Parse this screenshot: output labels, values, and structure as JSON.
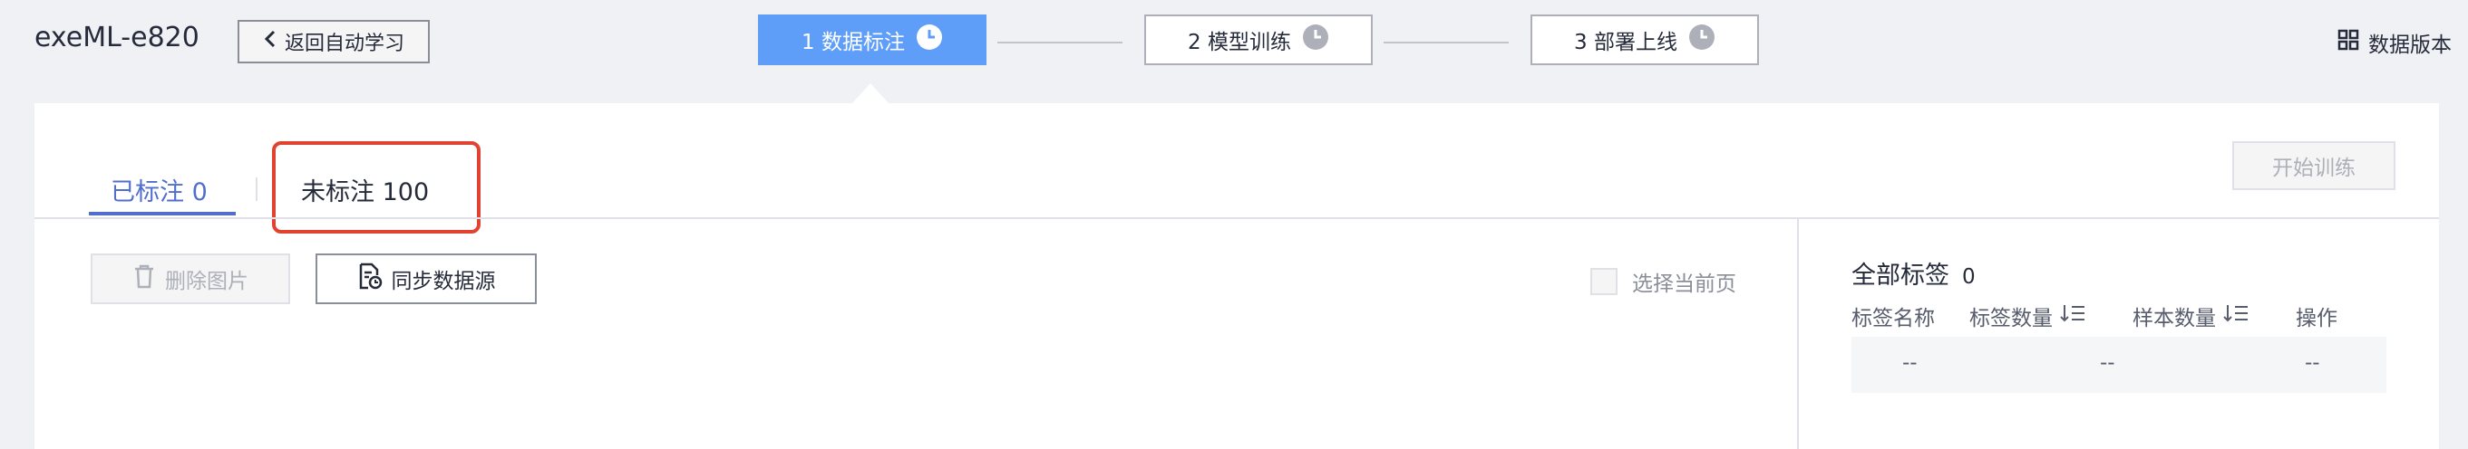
{
  "header": {
    "app_title": "exeML-e820",
    "back_label": "返回自动学习",
    "steps": [
      {
        "label": "1 数据标注",
        "active": true
      },
      {
        "label": "2 模型训练",
        "active": false
      },
      {
        "label": "3 部署上线",
        "active": false
      }
    ],
    "version_label": "数据版本"
  },
  "tabs": [
    {
      "label": "已标注 0",
      "selected": true
    },
    {
      "label": "未标注 100",
      "selected": false,
      "highlighted": true
    }
  ],
  "toolbar": {
    "start_training": "开始训练",
    "delete_images": "删除图片",
    "sync_source": "同步数据源",
    "select_current_page": "选择当前页"
  },
  "labels_panel": {
    "title": "全部标签",
    "count": "0",
    "columns": [
      "标签名称",
      "标签数量",
      "样本数量",
      "操作"
    ],
    "rows": [
      [
        "--",
        "--",
        "--"
      ]
    ]
  },
  "colors": {
    "accent": "#5e9ef8",
    "tab_active": "#526ecc",
    "highlight_box": "#e0432f"
  }
}
